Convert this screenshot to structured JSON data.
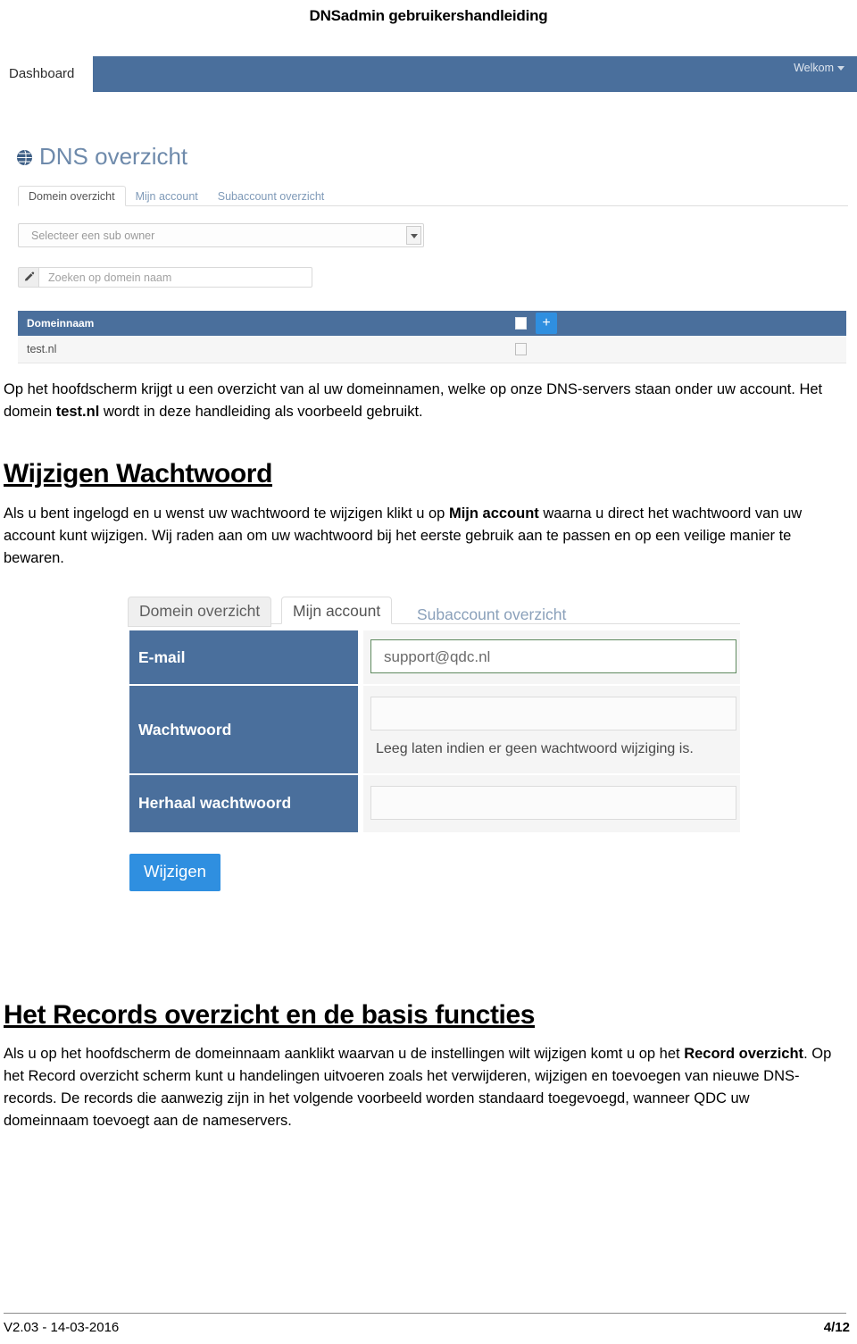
{
  "document": {
    "header_title": "DNSadmin gebruikershandleiding",
    "footer_version": "V2.03 - 14-03-2016",
    "footer_page": "4/12"
  },
  "colors": {
    "header_blue": "#4a6f9c",
    "accent_blue": "#2f8fe0",
    "heading_blue": "#6e8aab",
    "valid_green": "#5f8a5f"
  },
  "screenshot_dashboard": {
    "brand": "Dashboard",
    "welkom": "Welkom",
    "page_title": "DNS overzicht",
    "globe_icon": "globe-icon",
    "tabs": [
      {
        "label": "Domein overzicht",
        "active": true
      },
      {
        "label": "Mijn account",
        "active": false
      },
      {
        "label": "Subaccount overzicht",
        "active": false
      }
    ],
    "subowner_select": {
      "value": "Selecteer een sub owner",
      "caret_icon": "chevron-down-icon"
    },
    "search": {
      "placeholder": "Zoeken op domein naam",
      "addon_icon": "pencil-icon"
    },
    "table": {
      "column_header": "Domeinnaam",
      "add_button_label": "+",
      "rows": [
        {
          "domain": "test.nl"
        }
      ]
    }
  },
  "prose": {
    "p1_before": "Op het hoofdscherm krijgt u een overzicht van al uw domeinnamen, welke op onze DNS-servers staan onder uw account. Het domein ",
    "p1_bold": "test.nl",
    "p1_after": " wordt in deze handleiding als voorbeeld gebruikt.",
    "h_wijzigen": "Wijzigen Wachtwoord",
    "p2_before": "Als u bent ingelogd en u wenst uw wachtwoord te wijzigen klikt u op ",
    "p2_bold": "Mijn account",
    "p2_after": " waarna u direct het wachtwoord van uw account kunt wijzigen. Wij raden aan om uw wachtwoord bij het eerste gebruik aan te passen en op een veilige manier te bewaren.",
    "h_records": "Het Records overzicht en de basis functies",
    "p3_before": "Als u op het hoofdscherm de domeinnaam aanklikt waarvan u de instellingen wilt wijzigen komt u op het ",
    "p3_bold": "Record overzicht",
    "p3_after": ". Op het Record overzicht scherm kunt u handelingen uitvoeren zoals het verwijderen, wijzigen en toevoegen van nieuwe DNS-records. De records die aanwezig zijn in het volgende voorbeeld worden standaard toegevoegd, wanneer QDC uw domeinnaam toevoegt aan de nameservers."
  },
  "screenshot_account": {
    "tabs": [
      {
        "label": "Domein overzicht",
        "active": false
      },
      {
        "label": "Mijn account",
        "active": true
      },
      {
        "label": "Subaccount overzicht",
        "active": false
      }
    ],
    "fields": [
      {
        "label": "E-mail",
        "value": "support@qdc.nl",
        "hint": ""
      },
      {
        "label": "Wachtwoord",
        "value": "",
        "hint": "Leeg laten indien er geen wachtwoord wijziging is."
      },
      {
        "label": "Herhaal wachtwoord",
        "value": "",
        "hint": ""
      }
    ],
    "submit_label": "Wijzigen"
  }
}
